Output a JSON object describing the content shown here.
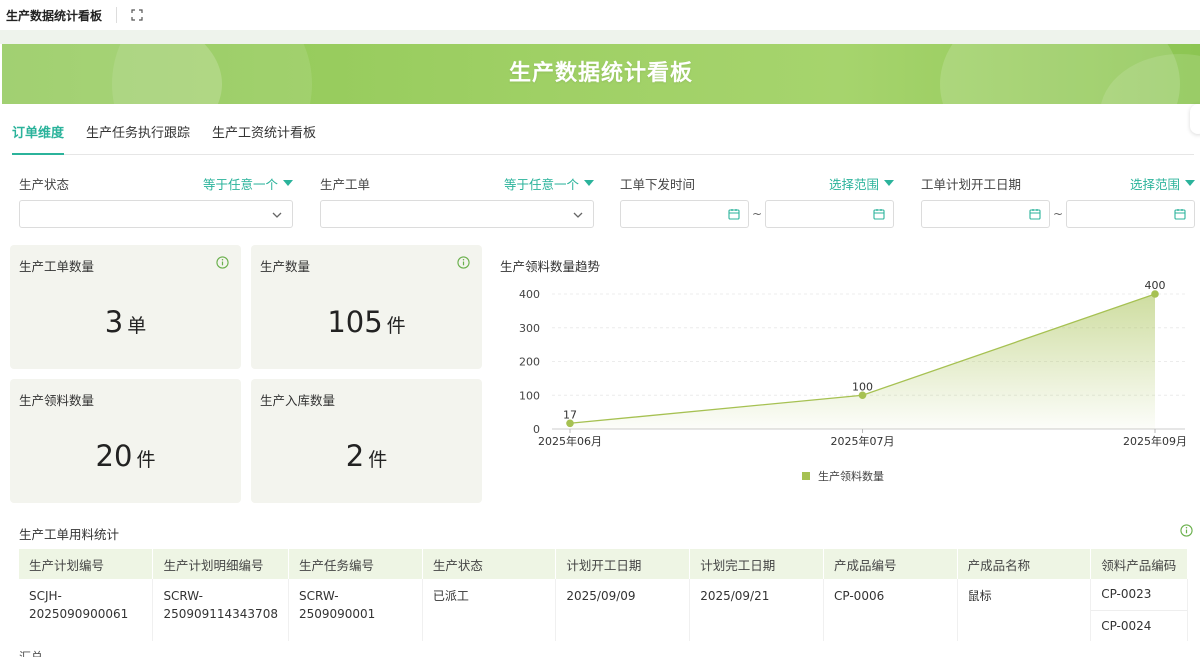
{
  "topbar": {
    "title": "生产数据统计看板"
  },
  "banner": {
    "title": "生产数据统计看板"
  },
  "tabs": [
    {
      "label": "订单维度",
      "active": true
    },
    {
      "label": "生产任务执行跟踪",
      "active": false
    },
    {
      "label": "生产工资统计看板",
      "active": false
    }
  ],
  "filters": [
    {
      "label": "生产状态",
      "operator": "等于任意一个"
    },
    {
      "label": "生产工单",
      "operator": "等于任意一个"
    },
    {
      "label": "工单下发时间",
      "operator": "选择范围",
      "separator": "~"
    },
    {
      "label": "工单计划开工日期",
      "operator": "选择范围",
      "separator": "~"
    }
  ],
  "cards": [
    {
      "title": "生产工单数量",
      "value": "3",
      "unit": "单",
      "info_icon": true
    },
    {
      "title": "生产数量",
      "value": "105",
      "unit": "件",
      "info_icon": true
    },
    {
      "title": "生产领料数量",
      "value": "20",
      "unit": "件",
      "info_icon": false
    },
    {
      "title": "生产入库数量",
      "value": "2",
      "unit": "件",
      "info_icon": false
    }
  ],
  "chart_data": {
    "type": "area",
    "title": "生产领料数量趋势",
    "categories": [
      "2025年06月",
      "2025年07月",
      "2025年09月"
    ],
    "series": [
      {
        "name": "生产领料数量",
        "values": [
          17,
          100,
          400
        ]
      }
    ],
    "yticks": [
      "0",
      "100",
      "200",
      "300",
      "400"
    ],
    "ylim": [
      0,
      400
    ],
    "legend": "bottom",
    "color": "#a6c152"
  },
  "table": {
    "title": "生产工单用料统计",
    "columns": [
      "生产计划编号",
      "生产计划明细编号",
      "生产任务编号",
      "生产状态",
      "计划开工日期",
      "计划完工日期",
      "产成品编号",
      "产成品名称",
      "领料产品编码"
    ],
    "rows": [
      {
        "plan_no": "SCJH-2025090900061",
        "plan_detail_line1": "SCRW-",
        "plan_detail_line2": "250909114343708",
        "task_no": "SCRW-2509090001",
        "status": "已派工",
        "start": "2025/09/09",
        "end": "2025/09/21",
        "product_no": "CP-0006",
        "product_name": "鼠标",
        "material_codes": [
          "CP-0023",
          "CP-0024"
        ]
      }
    ],
    "footer": "汇总"
  },
  "colors": {
    "accent": "#2bb39b",
    "banner": "#9fd065",
    "card_bg": "#f3f4ee"
  }
}
